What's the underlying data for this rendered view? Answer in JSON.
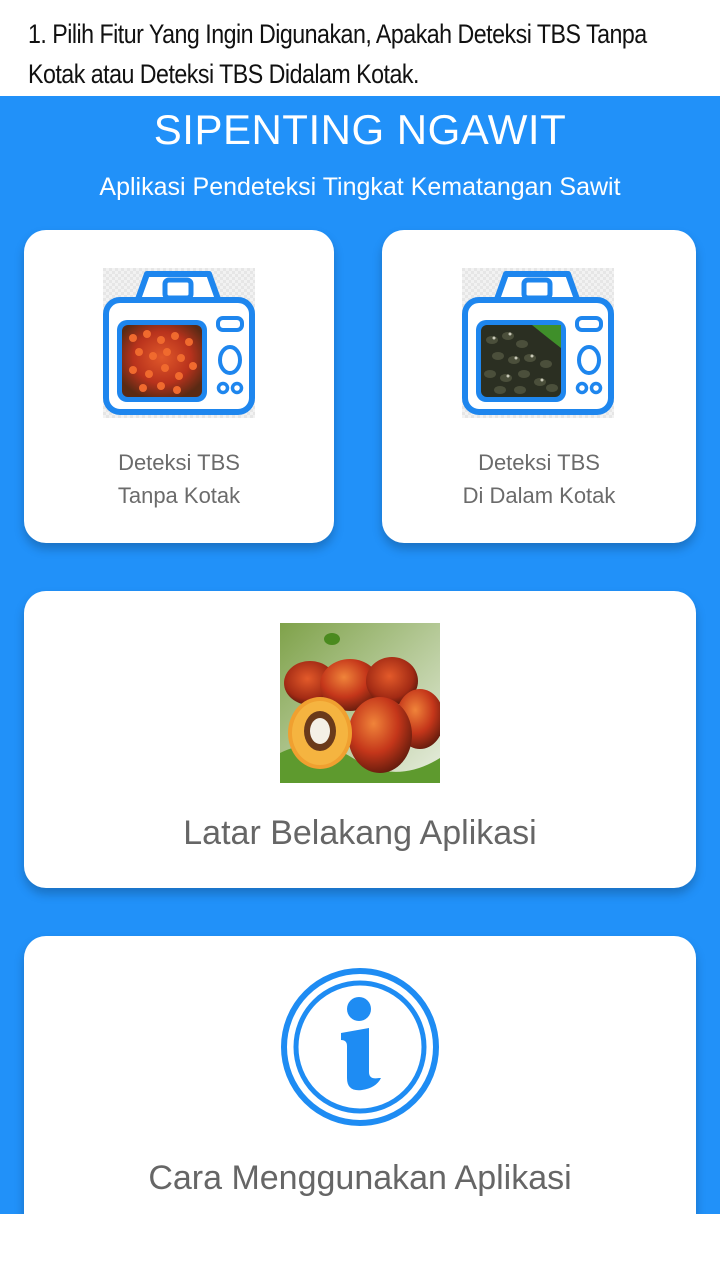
{
  "instruction": {
    "line1": "1. Pilih Fitur Yang Ingin Digunakan, Apakah Deteksi TBS Tanpa",
    "line2": "Kotak atau Deteksi TBS Didalam Kotak."
  },
  "app": {
    "title": "SIPENTING NGAWIT",
    "subtitle": "Aplikasi Pendeteksi Tingkat Kematangan Sawit",
    "accent_color": "#2191f9"
  },
  "cards": {
    "tanpa_kotak": {
      "line1": "Deteksi TBS",
      "line2": "Tanpa Kotak",
      "icon": "camera-icon"
    },
    "dalam_kotak": {
      "line1": "Deteksi TBS",
      "line2": "Di Dalam Kotak",
      "icon": "camera-icon"
    },
    "latar_belakang": {
      "label": "Latar Belakang Aplikasi",
      "image": "palm-fruit-image"
    },
    "cara_menggunakan": {
      "label": "Cara Menggunakan Aplikasi",
      "icon": "info-icon"
    }
  }
}
